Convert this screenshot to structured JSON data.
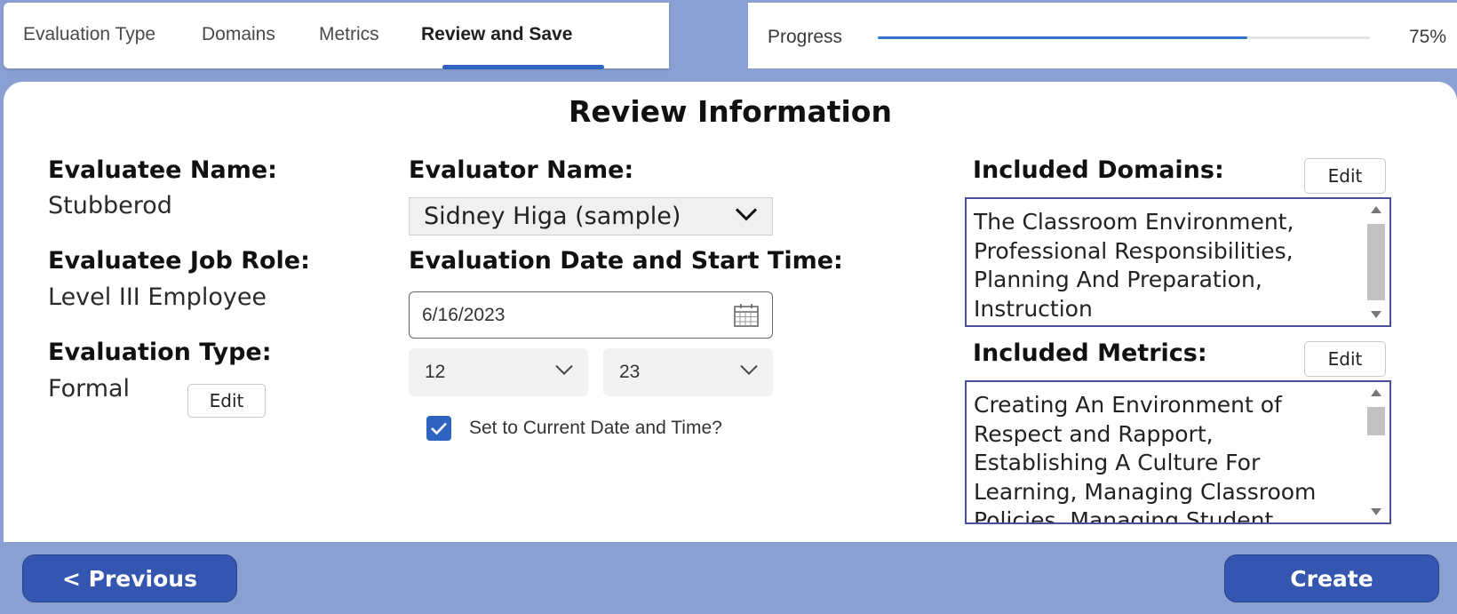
{
  "tabs": [
    {
      "label": "Evaluation Type"
    },
    {
      "label": "Domains"
    },
    {
      "label": "Metrics"
    },
    {
      "label": "Review and Save",
      "active": true
    }
  ],
  "progress": {
    "label": "Progress",
    "value_text": "75%",
    "fraction": 0.75
  },
  "page_title": "Review Information",
  "evaluatee": {
    "name_label": "Evaluatee Name:",
    "name": "Stubberod",
    "role_label": "Evaluatee Job Role:",
    "role": "Level III Employee",
    "type_label": "Evaluation Type:",
    "type": "Formal",
    "edit_label": "Edit"
  },
  "evaluator": {
    "name_label": "Evaluator Name:",
    "selected": "Sidney Higa (sample)",
    "date_label": "Evaluation Date and Start Time:",
    "date": "6/16/2023",
    "hour": "12",
    "minute": "23",
    "current_checkbox_label": "Set to Current Date and Time?",
    "current_checked": true
  },
  "domains": {
    "label": "Included Domains:",
    "edit_label": "Edit",
    "lines": [
      "The Classroom Environment,",
      "Professional Responsibilities,",
      "Planning And Preparation,",
      "Instruction"
    ]
  },
  "metrics": {
    "label": "Included Metrics:",
    "edit_label": "Edit",
    "lines": [
      "Creating An Environment of",
      "Respect and Rapport,",
      "Establishing A Culture For",
      "Learning, Managing Classroom",
      "Policies, Managing Student"
    ]
  },
  "footer": {
    "previous_label": "< Previous",
    "create_label": "Create"
  },
  "colors": {
    "accent": "#2e63c0",
    "footer_bg": "#8aa0d2",
    "nav_button": "#3556b0",
    "textbox_border": "#4a4f9c"
  }
}
